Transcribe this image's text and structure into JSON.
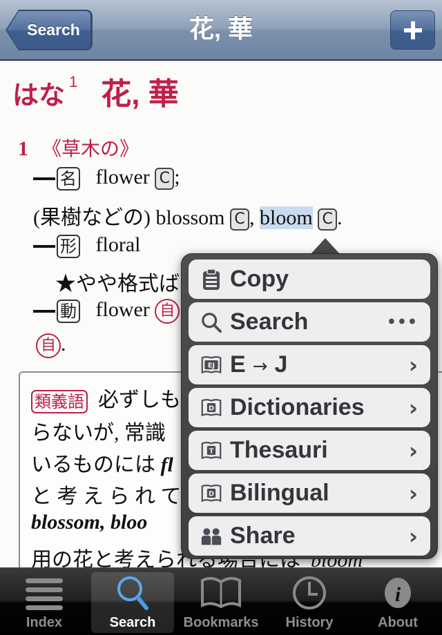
{
  "navbar": {
    "back_label": "Search",
    "title": "花, 華",
    "add_icon": "plus-icon"
  },
  "entry": {
    "reading": "はな",
    "homograph_number": "1",
    "kanji": "花, 華",
    "sense_number": "1",
    "sense_label": "《草木の》",
    "lines": {
      "noun_pos": "名",
      "noun_gloss": "flower",
      "countable": "C",
      "semicolon": ";",
      "fruit_note": "(果樹などの) blossom",
      "comma": ",",
      "bloom": "bloom",
      "period": ".",
      "adj_pos": "形",
      "adj_gloss": "floral",
      "adj_note": "★やや格式ば",
      "verb_pos": "動",
      "verb_gloss": "flower",
      "intransitive": "自",
      "verb_end": "."
    },
    "synonym_box": {
      "tag": "類義語",
      "line1": "必ずしも",
      "line2": "らないが, 常識",
      "line3_jp": "いるものには",
      "line3_en": "fl",
      "line4": "と 考 え ら れ て",
      "line5": "blossom, bloo",
      "line6_jp": "用の花と考えられる場合には",
      "line6_en": "bloom"
    }
  },
  "popup": {
    "items": [
      {
        "label": "Copy",
        "icon": "clipboard-icon",
        "trailing": ""
      },
      {
        "label": "Search",
        "icon": "search-icon",
        "trailing": "•••"
      },
      {
        "label_left": "E",
        "label_arrow": "→",
        "label_right": "J",
        "icon": "ej-book-icon",
        "icon_text": "EJ",
        "trailing": "›"
      },
      {
        "label": "Dictionaries",
        "icon": "dictionary-book-icon",
        "icon_text": "D",
        "trailing": "›"
      },
      {
        "label": "Thesauri",
        "icon": "thesaurus-book-icon",
        "icon_text": "T",
        "trailing": "›"
      },
      {
        "label": "Bilingual",
        "icon": "bilingual-book-icon",
        "icon_text": "D",
        "trailing": "›"
      },
      {
        "label": "Share",
        "icon": "people-icon",
        "trailing": "›"
      }
    ]
  },
  "tabbar": {
    "tabs": [
      {
        "label": "Index",
        "icon": "list-icon",
        "active": false
      },
      {
        "label": "Search",
        "icon": "magnifier-icon",
        "active": true
      },
      {
        "label": "Bookmarks",
        "icon": "book-icon",
        "active": false
      },
      {
        "label": "History",
        "icon": "clock-icon",
        "active": false
      },
      {
        "label": "About",
        "icon": "info-icon",
        "active": false
      }
    ]
  },
  "colors": {
    "accent_red": "#c01f48",
    "nav_blue": "#6e84a3",
    "selection": "#c9dbee",
    "active_tab_icon": "#5aa9f0"
  }
}
